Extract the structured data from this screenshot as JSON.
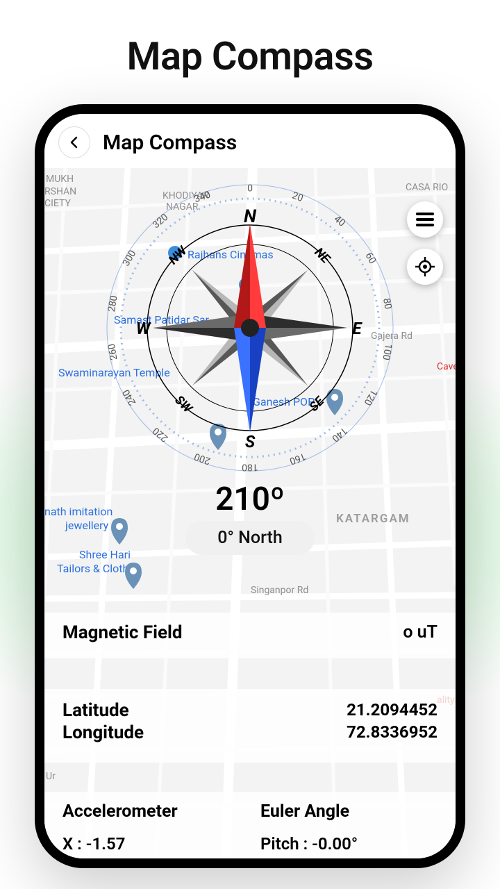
{
  "promo": {
    "title": "Map Compass"
  },
  "header": {
    "title": "Map Compass"
  },
  "fab": {
    "menu_name": "menu",
    "locate_name": "locate"
  },
  "compass": {
    "heading_deg": "210º",
    "north_label": "0°  North",
    "cardinals": {
      "n": "N",
      "ne": "NE",
      "e": "E",
      "se": "SE",
      "s": "S",
      "sw": "SW",
      "w": "W",
      "nw": "NW"
    },
    "ticks": [
      "0",
      "20",
      "40",
      "60",
      "80",
      "100",
      "120",
      "140",
      "160",
      "180",
      "200",
      "220",
      "240",
      "260",
      "280",
      "300",
      "320",
      "340"
    ]
  },
  "map": {
    "labels": {
      "khodiyar": "KHODIYAR",
      "nagar": "NAGAR",
      "casa": "CASA RIO",
      "mukh": "MUKH",
      "rshan": "RSHAN",
      "ciety": "CIETY",
      "katargam": "KATARGAM",
      "ality": "ality",
      "cave": "Cave",
      "ur": "Ur",
      "gajera": "Gajera Rd",
      "singanpor": "Singanpor Rd",
      "rajhans": "Rajhans Cinemas",
      "samast": "Samast Patidar Sar",
      "swami": "Swaminarayan Temple",
      "ganesh": "Ganesh POP",
      "nath1": "nath imitation",
      "nath2": "jewellery",
      "shree1": "Shree Hari",
      "shree2": "Tailors & Clothes"
    }
  },
  "magnetic": {
    "label": "Magnetic Field",
    "value": "o uT"
  },
  "location": {
    "lat_label": "Latitude",
    "lat_value": "21.2094452",
    "lon_label": "Longitude",
    "lon_value": "72.8336952"
  },
  "sensors": {
    "acc_label": "Accelerometer",
    "acc_x": "X : -1.57",
    "euler_label": "Euler Angle",
    "euler_pitch": "Pitch : -0.00°"
  }
}
